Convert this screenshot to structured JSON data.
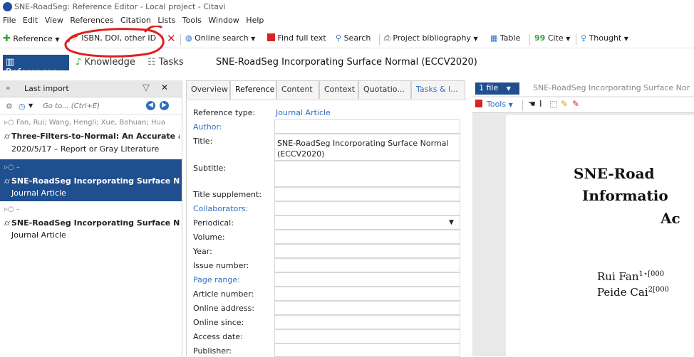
{
  "window": {
    "title": "SNE-RoadSeg: Reference Editor - Local project - Citavi"
  },
  "menu": [
    "File",
    "Edit",
    "View",
    "References",
    "Citation",
    "Lists",
    "Tools",
    "Window",
    "Help"
  ],
  "toolbar": {
    "reference": "Reference",
    "isbn": "ISBN, DOI, other ID",
    "online_search": "Online search",
    "find_full_text": "Find full text",
    "search": "Search",
    "project_bibliography": "Project bibliography",
    "table": "Table",
    "cite": "Cite",
    "thought": "Thought"
  },
  "nav": {
    "references": "References",
    "knowledge": "Knowledge",
    "tasks": "Tasks"
  },
  "page_title": "SNE-RoadSeg Incorporating Surface Normal  (ECCV2020)",
  "left": {
    "header": "Last import",
    "search_placeholder": "Go to... (Ctrl+E)",
    "items": [
      {
        "authors": "Fan, Rui; Wang, Hengli; Xue, Bohuan; Hua",
        "title": "Three-Filters-to-Normal: An Accurate an",
        "sub": "2020/5/17 – Report or Gray Literature"
      },
      {
        "authors": "–",
        "title": "SNE-RoadSeg Incorporating Surface Nor",
        "sub": "Journal Article"
      },
      {
        "authors": "–",
        "title": "SNE-RoadSeg Incorporating Surface Nor",
        "sub": "Journal Article"
      }
    ]
  },
  "tabs": [
    "Overview",
    "Reference",
    "Content",
    "Context",
    "Quotatio...",
    "Tasks & l..."
  ],
  "form": {
    "reference_type_label": "Reference type:",
    "reference_type_value": "Journal Article",
    "fields": [
      {
        "label": "Author:",
        "value": ""
      },
      {
        "label": "Title:",
        "value": "SNE-RoadSeg Incorporating Surface Normal (ECCV2020)"
      },
      {
        "label": "Subtitle:",
        "value": ""
      },
      {
        "label": "Title supplement:",
        "value": ""
      },
      {
        "label": "Collaborators:",
        "value": ""
      },
      {
        "label": "Periodical:",
        "value": ""
      },
      {
        "label": "Volume:",
        "value": ""
      },
      {
        "label": "Year:",
        "value": ""
      },
      {
        "label": "Issue number:",
        "value": ""
      },
      {
        "label": "Page range:",
        "value": ""
      },
      {
        "label": "Article number:",
        "value": ""
      },
      {
        "label": "Online address:",
        "value": ""
      },
      {
        "label": "Online since:",
        "value": ""
      },
      {
        "label": "Access date:",
        "value": ""
      },
      {
        "label": "Publisher:",
        "value": ""
      }
    ]
  },
  "preview": {
    "file_button": "1 file",
    "file_title": "SNE-RoadSeg Incorporating Surface Nor",
    "tools": "Tools",
    "pdf_line1": "SNE-Road",
    "pdf_line2": "Informatio",
    "pdf_line3": "Ac",
    "pdf_author1": "Rui Fan",
    "pdf_author1_sup": "1⋆[000",
    "pdf_author2": "Peide Cai",
    "pdf_author2_sup": "2[000"
  },
  "colors": {
    "accent": "#1f4f8f",
    "link": "#2c6fc2",
    "annotation": "#e02020"
  }
}
